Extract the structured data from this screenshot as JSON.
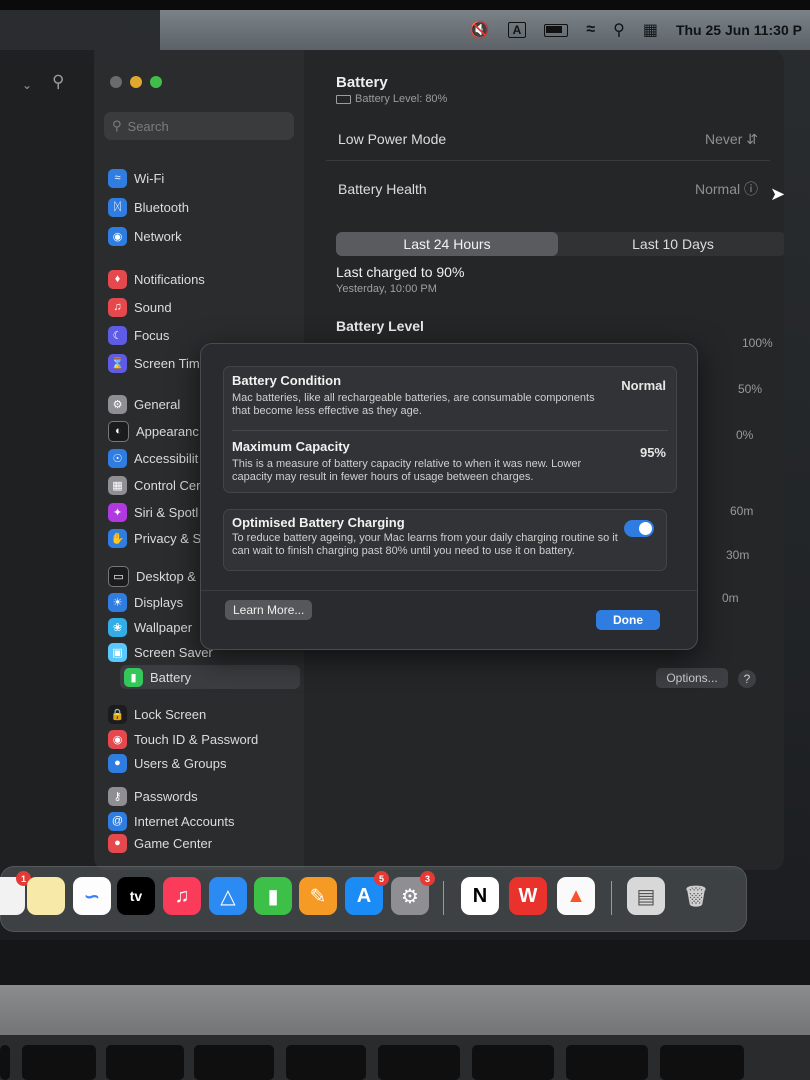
{
  "menubar": {
    "date_time": "Thu 25 Jun  11:30 P",
    "input_label": "A"
  },
  "settings": {
    "search_placeholder": "Search",
    "sidebar": [
      {
        "label": "Wi-Fi",
        "icon": "wifi-icon",
        "color": "#2f7de1"
      },
      {
        "label": "Bluetooth",
        "icon": "bluetooth-icon",
        "color": "#2f7de1"
      },
      {
        "label": "Network",
        "icon": "globe-icon",
        "color": "#2f7de1"
      },
      {
        "label": "Notifications",
        "icon": "bell-icon",
        "color": "#e5484d"
      },
      {
        "label": "Sound",
        "icon": "speaker-icon",
        "color": "#e5484d"
      },
      {
        "label": "Focus",
        "icon": "moon-icon",
        "color": "#5e5ce6"
      },
      {
        "label": "Screen Tim",
        "icon": "hourglass-icon",
        "color": "#5e5ce6"
      },
      {
        "label": "General",
        "icon": "gear-icon",
        "color": "#8e8e93"
      },
      {
        "label": "Appearanc",
        "icon": "appearance-icon",
        "color": "#1c1c1e"
      },
      {
        "label": "Accessibilit",
        "icon": "accessibility-icon",
        "color": "#2f7de1"
      },
      {
        "label": "Control Cer",
        "icon": "control-center-icon",
        "color": "#8e8e93"
      },
      {
        "label": "Siri & Spotl",
        "icon": "siri-icon",
        "color": "#b03ae0"
      },
      {
        "label": "Privacy & S",
        "icon": "hand-icon",
        "color": "#2f7de1"
      },
      {
        "label": "Desktop &",
        "icon": "desktop-icon",
        "color": "#1c1c1e"
      },
      {
        "label": "Displays",
        "icon": "sun-icon",
        "color": "#2f7de1"
      },
      {
        "label": "Wallpaper",
        "icon": "wallpaper-icon",
        "color": "#32ade6"
      },
      {
        "label": "Screen Saver",
        "icon": "screensaver-icon",
        "color": "#5ac8fa"
      },
      {
        "label": "Battery",
        "icon": "battery-icon",
        "color": "#34c759"
      },
      {
        "label": "Lock Screen",
        "icon": "lock-icon",
        "color": "#1c1c1e"
      },
      {
        "label": "Touch ID & Password",
        "icon": "fingerprint-icon",
        "color": "#e5484d"
      },
      {
        "label": "Users & Groups",
        "icon": "users-icon",
        "color": "#2f7de1"
      },
      {
        "label": "Passwords",
        "icon": "key-icon",
        "color": "#8e8e93"
      },
      {
        "label": "Internet Accounts",
        "icon": "at-icon",
        "color": "#2f7de1"
      },
      {
        "label": "Game Center",
        "icon": "gamecenter-icon",
        "color": "#e5484d"
      }
    ],
    "main": {
      "title": "Battery",
      "subtitle": "Battery Level: 80%",
      "low_power_label": "Low Power Mode",
      "low_power_value": "Never",
      "health_label": "Battery Health",
      "health_value": "Normal",
      "tab_24h": "Last 24 Hours",
      "tab_10d": "Last 10 Days",
      "last_charged": "Last charged to 90%",
      "last_charged_time": "Yesterday, 10:00 PM",
      "battery_level_title": "Battery Level",
      "axis_100": "100%",
      "axis_50": "50%",
      "axis_0": "0%",
      "axis_60m": "60m",
      "axis_30m": "30m",
      "axis_0m": "0m",
      "options_label": "Options...",
      "help_label": "?"
    }
  },
  "modal": {
    "condition_title": "Battery Condition",
    "condition_desc": "Mac batteries, like all rechargeable batteries, are consumable components that become less effective as they age.",
    "condition_value": "Normal",
    "capacity_title": "Maximum Capacity",
    "capacity_desc": "This is a measure of battery capacity relative to when it was new. Lower capacity may result in fewer hours of usage between charges.",
    "capacity_value": "95%",
    "optimised_title": "Optimised Battery Charging",
    "optimised_desc": "To reduce battery ageing, your Mac learns from your daily charging routine so it can wait to finish charging past 80% until you need to use it on battery.",
    "optimised_on": true,
    "learn_more": "Learn More...",
    "done": "Done"
  },
  "dock": {
    "tv_label": "tv",
    "badges": {
      "app_store": "5",
      "settings": "3",
      "first": "1"
    }
  }
}
